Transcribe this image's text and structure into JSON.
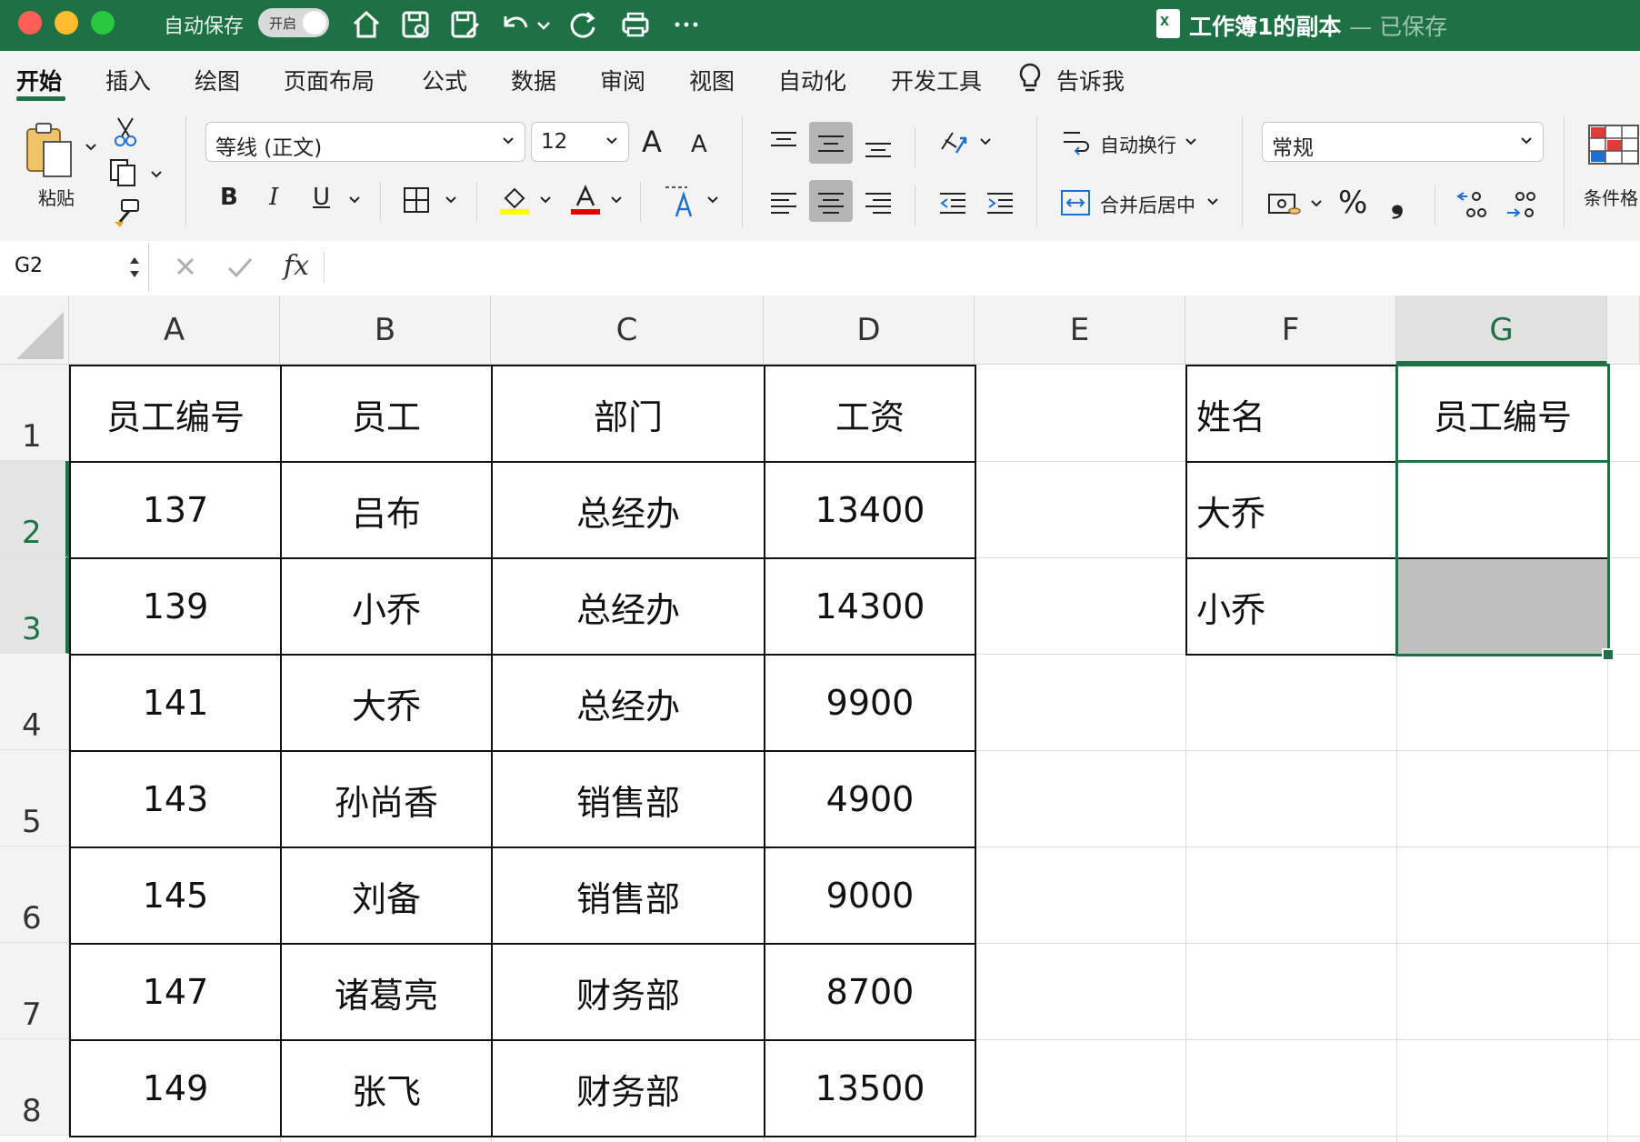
{
  "title_bar": {
    "autosave_label": "自动保存",
    "autosave_state": "开启",
    "doc_title": "工作簿1的副本",
    "doc_status": "— 已保存",
    "doc_icon_text": "X"
  },
  "tabs": [
    {
      "label": "开始",
      "active": true
    },
    {
      "label": "插入"
    },
    {
      "label": "绘图"
    },
    {
      "label": "页面布局"
    },
    {
      "label": "公式"
    },
    {
      "label": "数据"
    },
    {
      "label": "审阅"
    },
    {
      "label": "视图"
    },
    {
      "label": "自动化"
    },
    {
      "label": "开发工具"
    },
    {
      "label": "告诉我"
    }
  ],
  "ribbon": {
    "paste_label": "粘贴",
    "font_name": "等线 (正文)",
    "font_size": "12",
    "bold": "B",
    "italic": "I",
    "underline": "U",
    "grow_font": "A",
    "shrink_font": "A",
    "wrap_text": "自动换行",
    "merge_center": "合并后居中",
    "number_format": "常规",
    "percent": "%",
    "comma": "❟",
    "conditional_format": "条件格",
    "fill_color": "#ffff00",
    "font_color": "#e00000"
  },
  "formula_bar": {
    "name_box": "G2",
    "fx_label": "fx",
    "formula": ""
  },
  "grid": {
    "columns": [
      "A",
      "B",
      "C",
      "D",
      "E",
      "F",
      "G"
    ],
    "selected_column": "G",
    "rows": [
      "1",
      "2",
      "3",
      "4",
      "5",
      "6",
      "7",
      "8"
    ],
    "selected_rows": [
      "2",
      "3"
    ],
    "table": {
      "headers": [
        "员工编号",
        "员工",
        "部门",
        "工资"
      ],
      "rows": [
        [
          "137",
          "吕布",
          "总经办",
          "13400"
        ],
        [
          "139",
          "小乔",
          "总经办",
          "14300"
        ],
        [
          "141",
          "大乔",
          "总经办",
          "9900"
        ],
        [
          "143",
          "孙尚香",
          "销售部",
          "4900"
        ],
        [
          "145",
          "刘备",
          "销售部",
          "9000"
        ],
        [
          "147",
          "诸葛亮",
          "财务部",
          "8700"
        ],
        [
          "149",
          "张飞",
          "财务部",
          "13500"
        ]
      ]
    },
    "lookup": {
      "headers": [
        "姓名",
        "员工编号"
      ],
      "rows": [
        [
          "大乔",
          ""
        ],
        [
          "小乔",
          ""
        ]
      ]
    },
    "highlight_color": "#bfbfbf",
    "accent_color": "#1e7145"
  }
}
